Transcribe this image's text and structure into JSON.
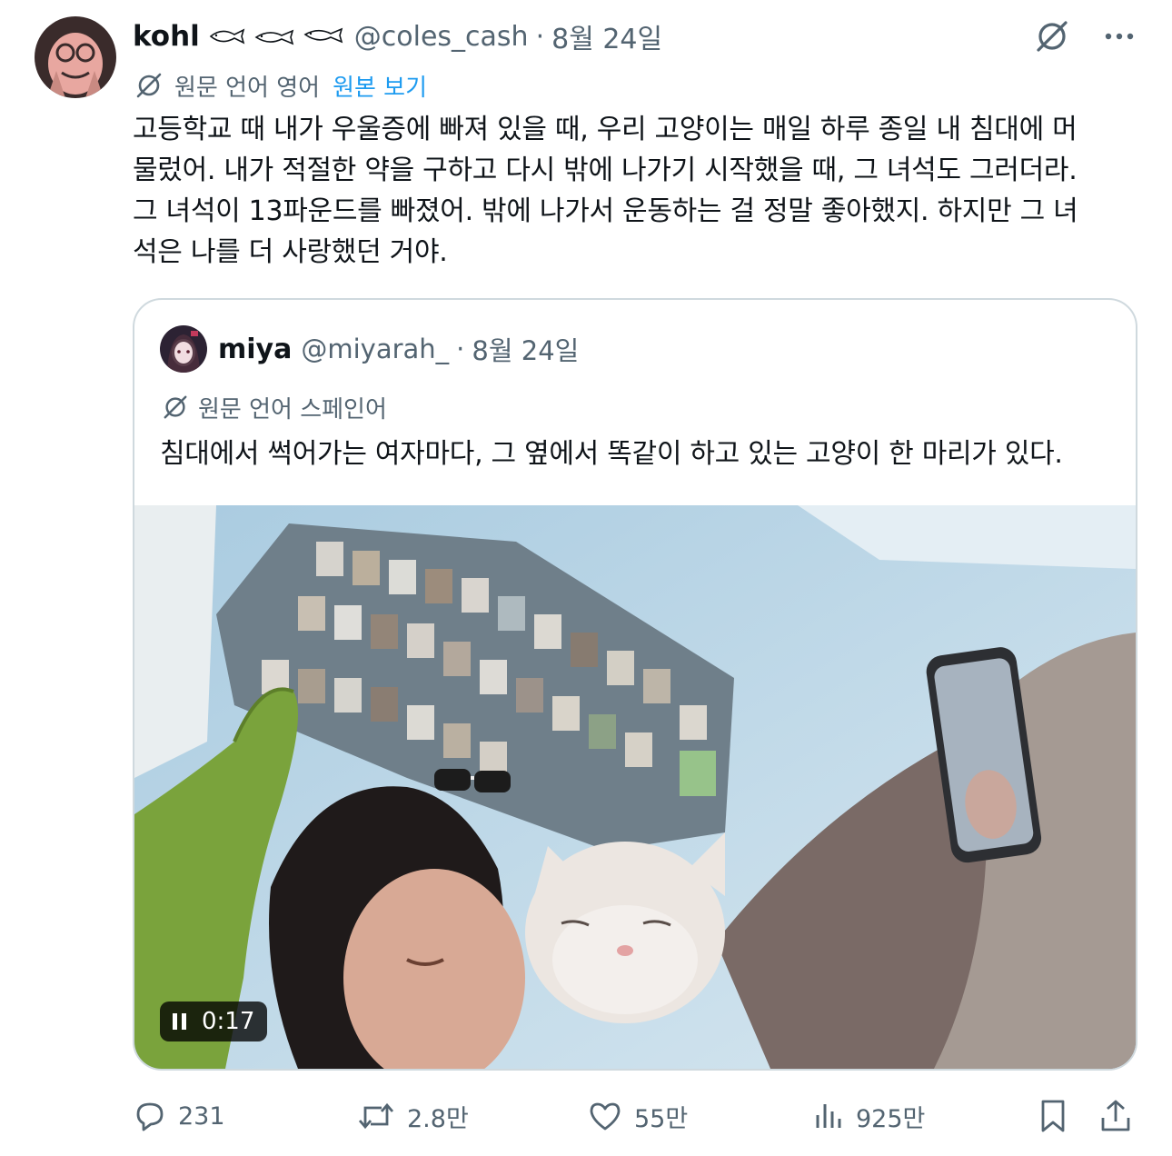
{
  "tweet": {
    "author_name": "kohl",
    "handle": "@coles_cash",
    "separator": "·",
    "date": "8월 24일",
    "translation": {
      "label": "원문 언어 영어",
      "show_original": "원본 보기"
    },
    "text": "고등학교 때 내가 우울증에 빠져 있을 때, 우리 고양이는 매일 하루 종일 내 침대에 머\n물렀어. 내가 적절한 약을 구하고 다시 밖에 나가기 시작했을 때, 그 녀석도 그러더라.\n그 녀석이 13파운드를 빠졌어. 밖에 나가서 운동하는 걸 정말 좋아했지. 하지만 그 녀\n석은 나를 더 사랑했던 거야."
  },
  "quote": {
    "author_name": "miya",
    "handle": "@miyarah_",
    "separator": "·",
    "date": "8월 24일",
    "translation_label": "원문 언어 스페인어",
    "text": "침대에서 썩어가는 여자마다, 그 옆에서 똑같이 하고 있는 고양이 한 마리가 있다.",
    "video_time": "0:17"
  },
  "actions": {
    "replies": "231",
    "reposts": "2.8만",
    "likes": "55만",
    "views": "925만"
  },
  "colors": {
    "secondary_text": "#536471",
    "link": "#1d9bf0",
    "border": "#cfd9de"
  }
}
